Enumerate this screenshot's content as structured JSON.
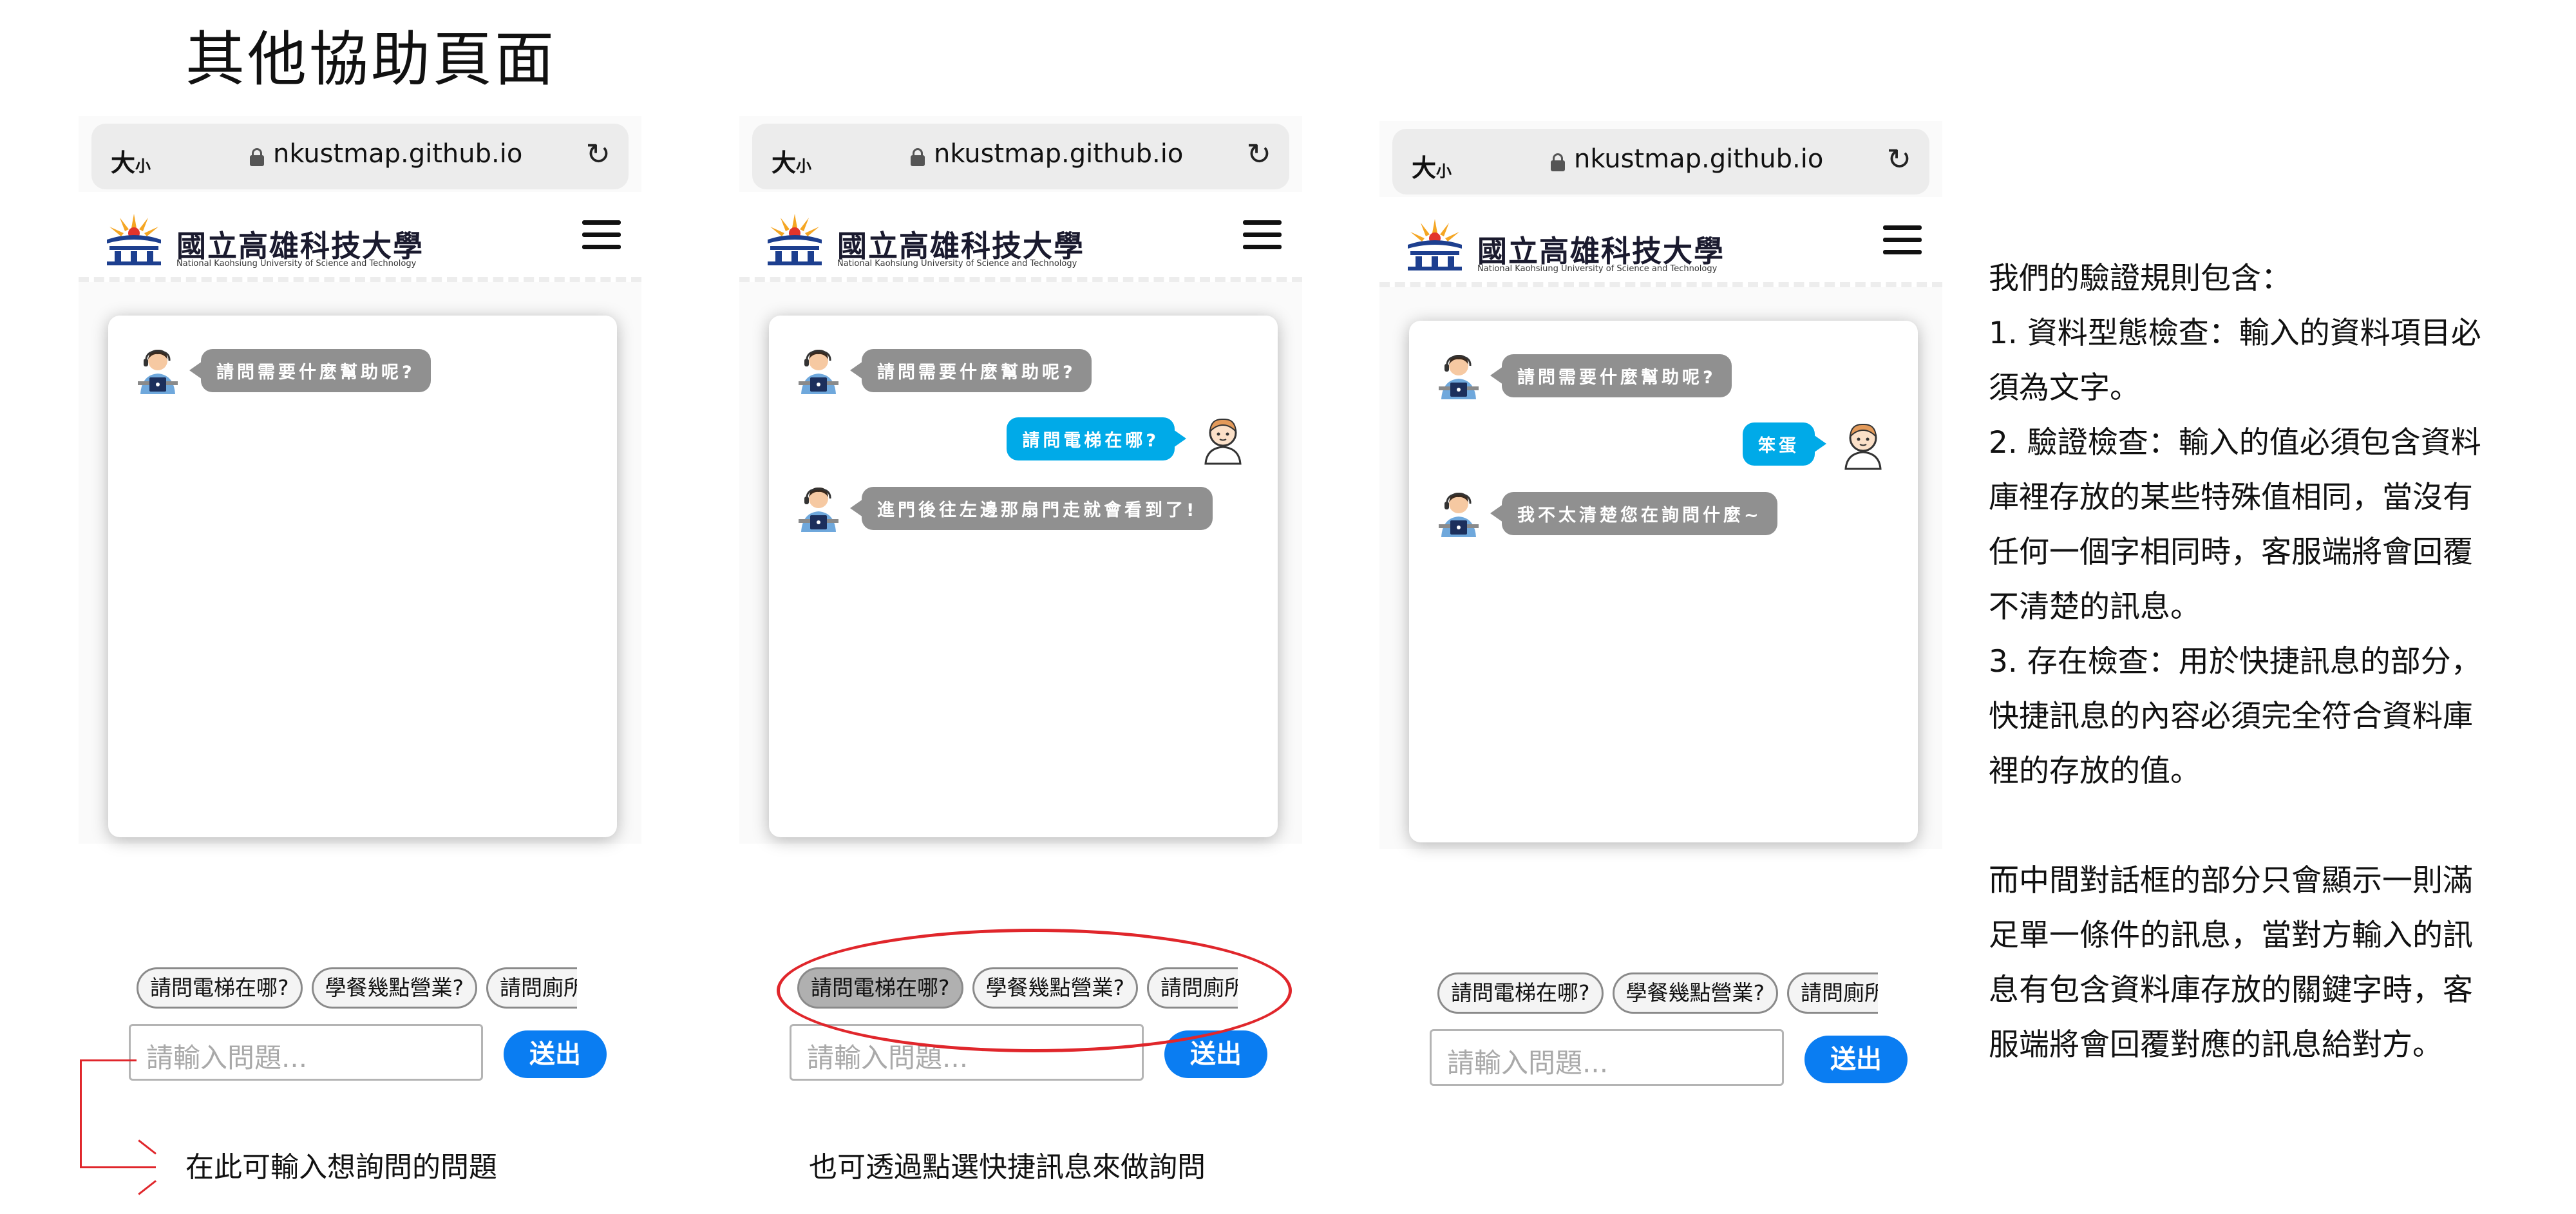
{
  "page": {
    "title": "其他協助頁面"
  },
  "browser": {
    "text_size_big": "大",
    "text_size_small": "小",
    "url": "nkustmap.github.io"
  },
  "site": {
    "name_cn": "國立高雄科技大學",
    "name_en": "National Kaohsiung University of Science and Technology"
  },
  "chat": {
    "input_placeholder": "請輸入問題...",
    "send_label": "送出",
    "quick_replies": [
      "請問電梯在哪?",
      "學餐幾點營業?",
      "請問廁所"
    ]
  },
  "screens": [
    {
      "messages": [
        {
          "from": "bot",
          "text": "請問需要什麼幫助呢?"
        }
      ],
      "caption": "在此可輸入想詢問的問題"
    },
    {
      "messages": [
        {
          "from": "bot",
          "text": "請問需要什麼幫助呢?"
        },
        {
          "from": "user",
          "text": "請問電梯在哪?"
        },
        {
          "from": "bot",
          "text": "進門後往左邊那扇門走就會看到了!"
        }
      ],
      "caption": "也可透過點選快捷訊息來做詢問"
    },
    {
      "messages": [
        {
          "from": "bot",
          "text": "請問需要什麼幫助呢?"
        },
        {
          "from": "user",
          "text": "笨蛋"
        },
        {
          "from": "bot",
          "text": "我不太清楚您在詢問什麼~"
        }
      ]
    }
  ],
  "explanation": {
    "lines": [
      "我們的驗證規則包含：",
      "1. 資料型態檢查：輸入的資料項目必",
      "須為文字。",
      "2. 驗證檢查：輸入的值必須包含資料",
      "庫裡存放的某些特殊值相同，當沒有",
      "任何一個字相同時，客服端將會回覆",
      "不清楚的訊息。",
      "3. 存在檢查：用於快捷訊息的部分，",
      "快捷訊息的內容必須完全符合資料庫",
      "裡的存放的值。"
    ],
    "lines2": [
      "而中間對話框的部分只會顯示一則滿",
      "足單一條件的訊息，當對方輸入的訊",
      "息有包含資料庫存放的關鍵字時，客",
      "服端將會回覆對應的訊息給對方。"
    ]
  },
  "colors": {
    "bot_bubble": "#909090",
    "user_bubble": "#00aae8",
    "send_button": "#0a7df2",
    "highlight": "#e0262b"
  },
  "icons": [
    "lock-icon",
    "reload-icon",
    "menu-icon",
    "bot-avatar-icon",
    "user-avatar-icon",
    "school-logo-icon"
  ]
}
